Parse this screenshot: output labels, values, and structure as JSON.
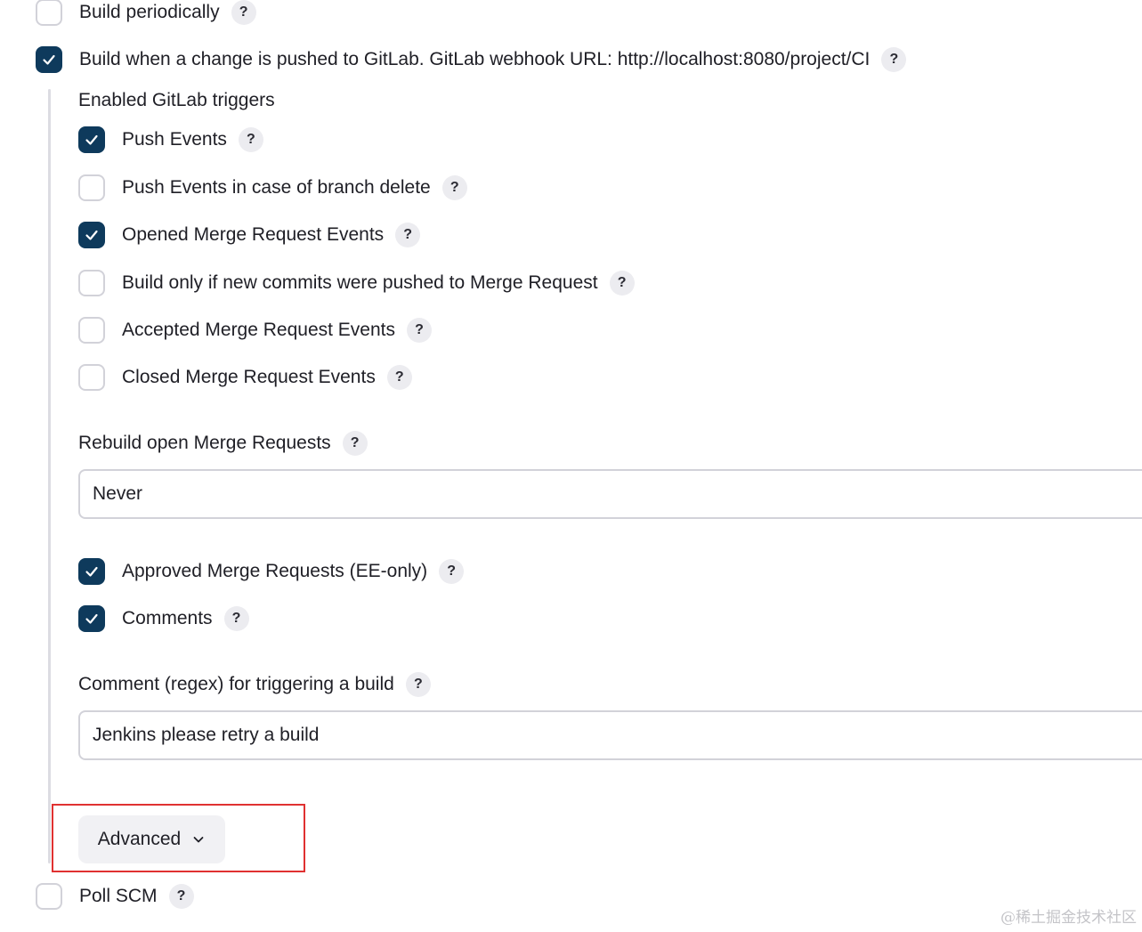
{
  "top_options": {
    "build_periodically": {
      "label": "Build periodically",
      "checked": false,
      "help": "?"
    },
    "gitlab_push": {
      "label": "Build when a change is pushed to GitLab. GitLab webhook URL: http://localhost:8080/project/CI",
      "checked": true,
      "help": "?"
    }
  },
  "triggers": {
    "heading": "Enabled GitLab triggers",
    "items": [
      {
        "label": "Push Events",
        "checked": true,
        "help": "?"
      },
      {
        "label": "Push Events in case of branch delete",
        "checked": false,
        "help": "?"
      },
      {
        "label": "Opened Merge Request Events",
        "checked": true,
        "help": "?"
      },
      {
        "label": "Build only if new commits were pushed to Merge Request",
        "checked": false,
        "help": "?"
      },
      {
        "label": "Accepted Merge Request Events",
        "checked": false,
        "help": "?"
      },
      {
        "label": "Closed Merge Request Events",
        "checked": false,
        "help": "?"
      }
    ]
  },
  "rebuild": {
    "label": "Rebuild open Merge Requests",
    "help": "?",
    "value": "Never"
  },
  "more_triggers": [
    {
      "label": "Approved Merge Requests (EE-only)",
      "checked": true,
      "help": "?"
    },
    {
      "label": "Comments",
      "checked": true,
      "help": "?"
    }
  ],
  "comment_regex": {
    "label": "Comment (regex) for triggering a build",
    "help": "?",
    "value": "Jenkins please retry a build"
  },
  "advanced": {
    "label": "Advanced"
  },
  "poll_scm": {
    "label": "Poll SCM",
    "checked": false,
    "help": "?"
  },
  "watermark": "@稀土掘金技术社区",
  "colors": {
    "accent": "#0e3a5c",
    "highlight": "#e03131",
    "help_bg": "#ececf0"
  }
}
